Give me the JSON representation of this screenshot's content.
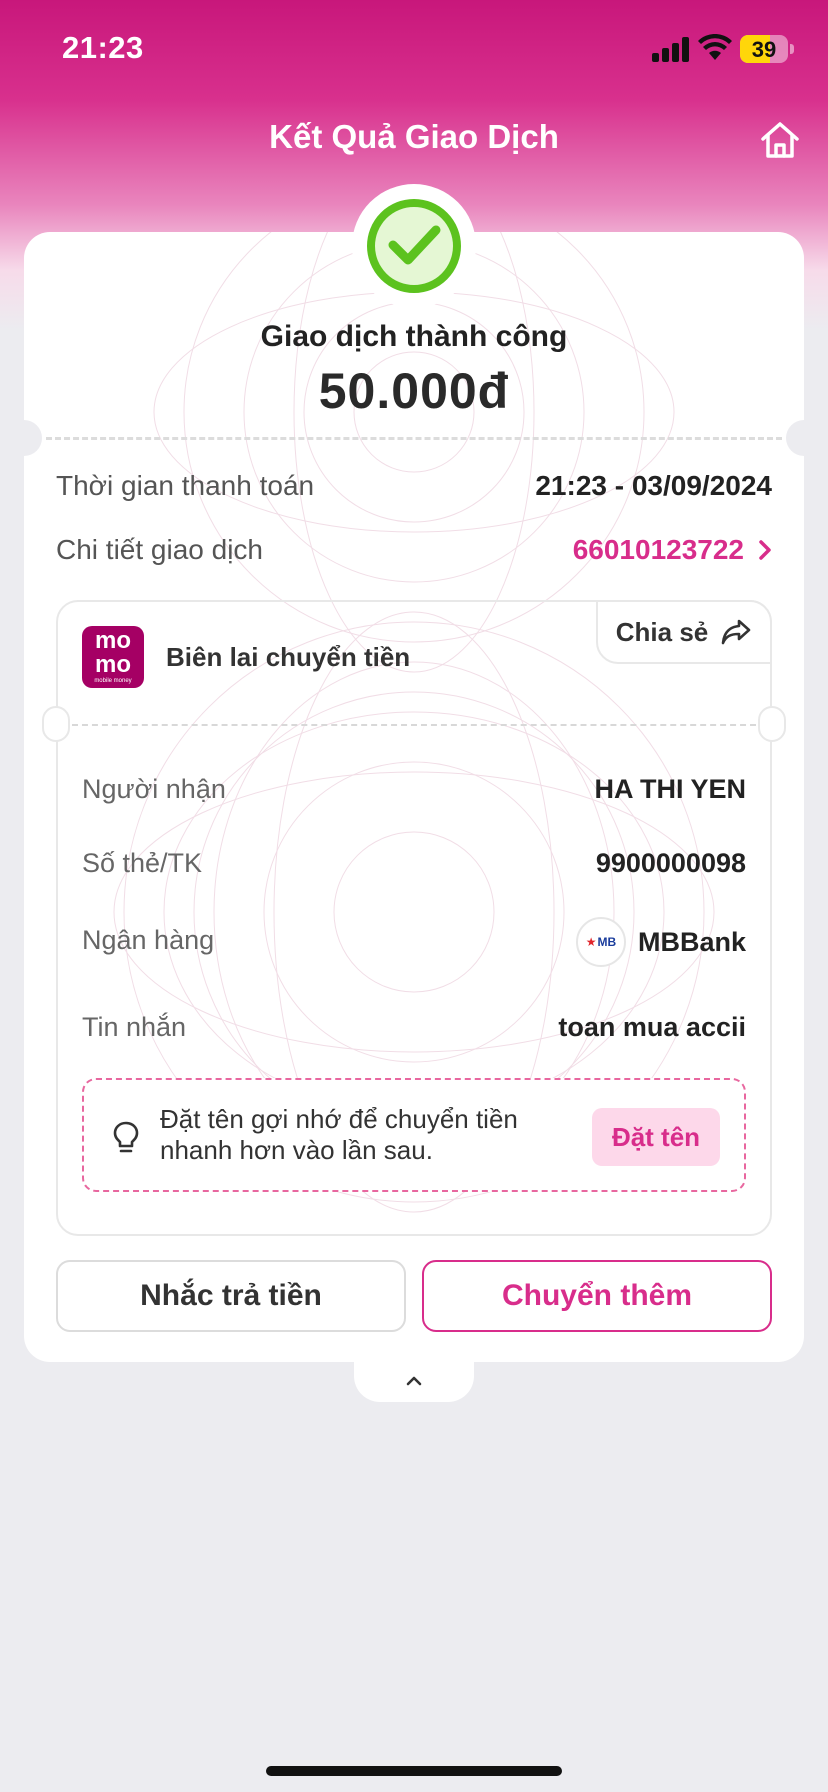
{
  "status_bar": {
    "time": "21:23",
    "battery": "39"
  },
  "header": {
    "title": "Kết Quả Giao Dịch"
  },
  "result": {
    "status_text": "Giao dịch thành công",
    "amount": "50.000đ"
  },
  "summary": {
    "time_label": "Thời gian thanh toán",
    "time_value": "21:23 - 03/09/2024",
    "detail_label": "Chi tiết giao dịch",
    "detail_value": "66010123722"
  },
  "receipt": {
    "logo_text_top": "mo",
    "logo_text_bottom": "mo",
    "logo_subtext": "mobile money",
    "title": "Biên lai chuyển tiền",
    "share_label": "Chia sẻ",
    "rows": [
      {
        "label": "Người nhận",
        "value": "HA THI YEN"
      },
      {
        "label": "Số thẻ/TK",
        "value": "9900000098"
      },
      {
        "label": "Ngân hàng",
        "value": "MBBank"
      },
      {
        "label": "Tin nhắn",
        "value": "toan mua accii"
      }
    ],
    "bank_logo_text": "MB",
    "hint_text": "Đặt tên gợi nhớ để chuyển tiền nhanh hơn vào lần sau.",
    "hint_button": "Đặt tên"
  },
  "actions": {
    "remind_label": "Nhắc trả tiền",
    "transfer_label": "Chuyển thêm"
  },
  "colors": {
    "brand": "#d82d8b",
    "momo": "#a50064",
    "success": "#5cc21e"
  },
  "icons": [
    "home-icon",
    "check-circle-icon",
    "chevron-right-icon",
    "share-arrow-icon",
    "lightbulb-icon",
    "chevron-up-icon"
  ]
}
